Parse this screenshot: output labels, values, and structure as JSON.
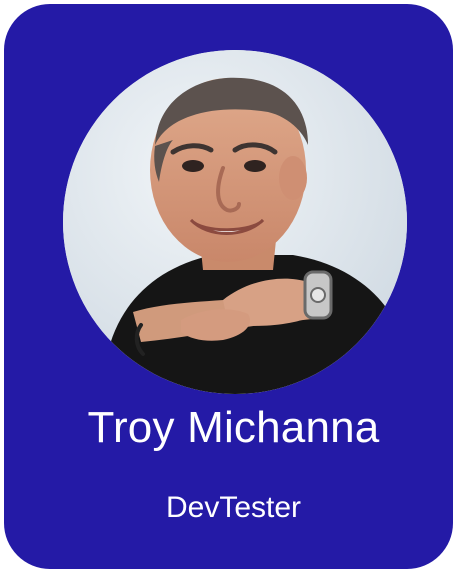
{
  "card": {
    "background_color": "#241aa6",
    "name": "Troy Michanna",
    "role": "DevTester",
    "avatar": {
      "alt_semantic": "profile-photo",
      "shape": "circle"
    }
  }
}
